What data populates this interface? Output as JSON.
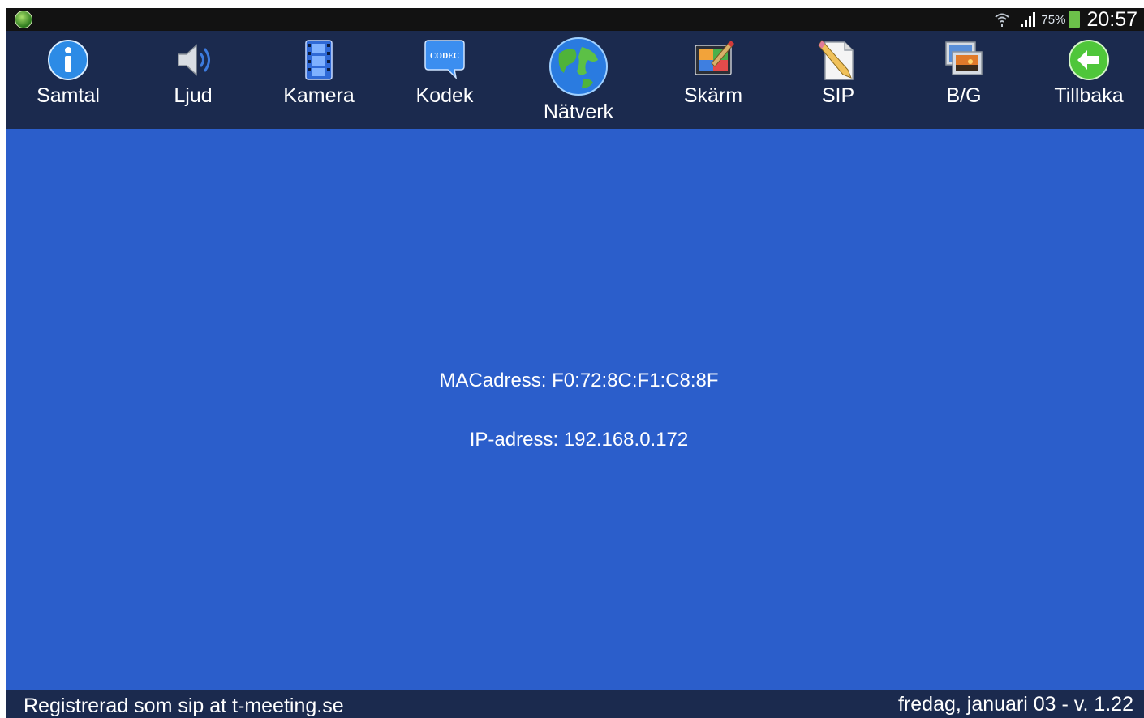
{
  "status_bar": {
    "battery_percent": "75%",
    "time": "20:57",
    "icons": [
      "app-logo-icon",
      "wifi-icon",
      "signal-icon",
      "battery-icon"
    ]
  },
  "toolbar": {
    "items": [
      {
        "label": "Samtal",
        "icon": "info-icon"
      },
      {
        "label": "Ljud",
        "icon": "speaker-icon"
      },
      {
        "label": "Kamera",
        "icon": "film-strip-icon"
      },
      {
        "label": "Kodek",
        "icon": "codec-bubble-icon",
        "icon_text": "CODEC"
      },
      {
        "label": "Nätverk",
        "icon": "globe-icon",
        "active": true
      },
      {
        "label": "Skärm",
        "icon": "screen-paint-icon"
      },
      {
        "label": "SIP",
        "icon": "document-pencil-icon"
      },
      {
        "label": "B/G",
        "icon": "picture-stack-icon"
      },
      {
        "label": "Tillbaka",
        "icon": "back-arrow-icon"
      }
    ]
  },
  "network": {
    "mac_line": "MACadress: F0:72:8C:F1:C8:8F",
    "ip_line": "IP-adress: 192.168.0.172"
  },
  "footer": {
    "registration": "Registrerad som sip at t-meeting.se",
    "date_version": "fredag, januari 03 - v. 1.22"
  },
  "colors": {
    "panel_blue": "#2b5ecb",
    "toolbar_navy": "#1b2a4e",
    "status_bar": "#121212"
  }
}
